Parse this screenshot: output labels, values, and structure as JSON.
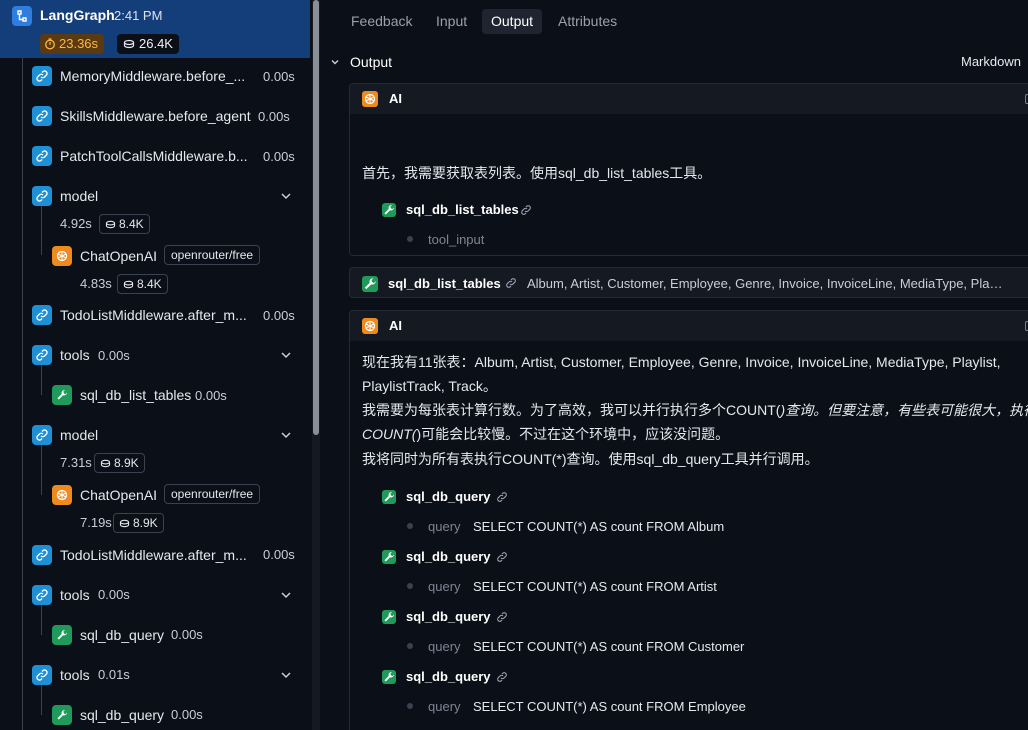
{
  "tree": {
    "root": {
      "title": "LangGraph",
      "time": "2:41 PM",
      "duration": "23.36s",
      "tokens": "26.4K"
    },
    "nodes": [
      {
        "label": "MemoryMiddleware.before_...",
        "dur": "0.00s"
      },
      {
        "label": "SkillsMiddleware.before_agent",
        "dur": "0.00s"
      },
      {
        "label": "PatchToolCallsMiddleware.b...",
        "dur": "0.00s"
      },
      {
        "label": "model",
        "sub_dur": "4.92s",
        "sub_tok": "8.4K"
      },
      {
        "label": "ChatOpenAI",
        "badge": "openrouter/free",
        "sub_dur": "4.83s",
        "sub_tok": "8.4K"
      },
      {
        "label": "TodoListMiddleware.after_m...",
        "dur": "0.00s"
      },
      {
        "label": "tools",
        "dur": "0.00s"
      },
      {
        "label": "sql_db_list_tables",
        "dur": "0.00s"
      },
      {
        "label": "model",
        "sub_dur": "7.31s",
        "sub_tok": "8.9K"
      },
      {
        "label": "ChatOpenAI",
        "badge": "openrouter/free",
        "sub_dur": "7.19s",
        "sub_tok": "8.9K"
      },
      {
        "label": "TodoListMiddleware.after_m...",
        "dur": "0.00s"
      },
      {
        "label": "tools",
        "dur": "0.00s"
      },
      {
        "label": "sql_db_query",
        "dur": "0.00s"
      },
      {
        "label": "tools",
        "dur": "0.01s"
      },
      {
        "label": "sql_db_query",
        "dur": "0.00s"
      }
    ]
  },
  "tabs": [
    "Feedback",
    "Input",
    "Output",
    "Attributes"
  ],
  "active_tab": "Output",
  "output": {
    "title": "Output",
    "format": "Markdown",
    "card1": {
      "role": "AI",
      "text": "首先，我需要获取表列表。使用sql_db_list_tables工具。",
      "tool_call": {
        "name": "sql_db_list_tables",
        "arg_key": "tool_input"
      }
    },
    "tool_result": {
      "name": "sql_db_list_tables",
      "content": "Album, Artist, Customer, Employee, Genre, Invoice, InvoiceLine, MediaType, Playli..."
    },
    "card2": {
      "role": "AI",
      "line1": "现在我有11张表：Album, Artist, Customer, Employee, Genre, Invoice, InvoiceLine, MediaType, Playlist,",
      "line2": "PlaylistTrack, Track。",
      "line3a": "我需要为每张表计算行数。为了高效，我可以并行执行多个COUNT(",
      "line3b": ")查询。但要注意，有些表可能很大，执行",
      "line4a": "COUNT(",
      "line4b": ")可能会比较慢。不过在这个环境中，应该没问题。",
      "line5": "我将同时为所有表执行COUNT(*)查询。使用sql_db_query工具并行调用。",
      "tool_calls": [
        {
          "name": "sql_db_query",
          "arg_key": "query",
          "arg_val": "SELECT COUNT(*) AS count FROM Album"
        },
        {
          "name": "sql_db_query",
          "arg_key": "query",
          "arg_val": "SELECT COUNT(*) AS count FROM Artist"
        },
        {
          "name": "sql_db_query",
          "arg_key": "query",
          "arg_val": "SELECT COUNT(*) AS count FROM Customer"
        },
        {
          "name": "sql_db_query",
          "arg_key": "query",
          "arg_val": "SELECT COUNT(*) AS count FROM Employee"
        }
      ]
    }
  },
  "colors": {
    "accent": "#143e7a",
    "chain": "#1f8fd6",
    "tool": "#1f9a5a",
    "llm": "#ee8a1e",
    "duration": "#ffb547"
  }
}
